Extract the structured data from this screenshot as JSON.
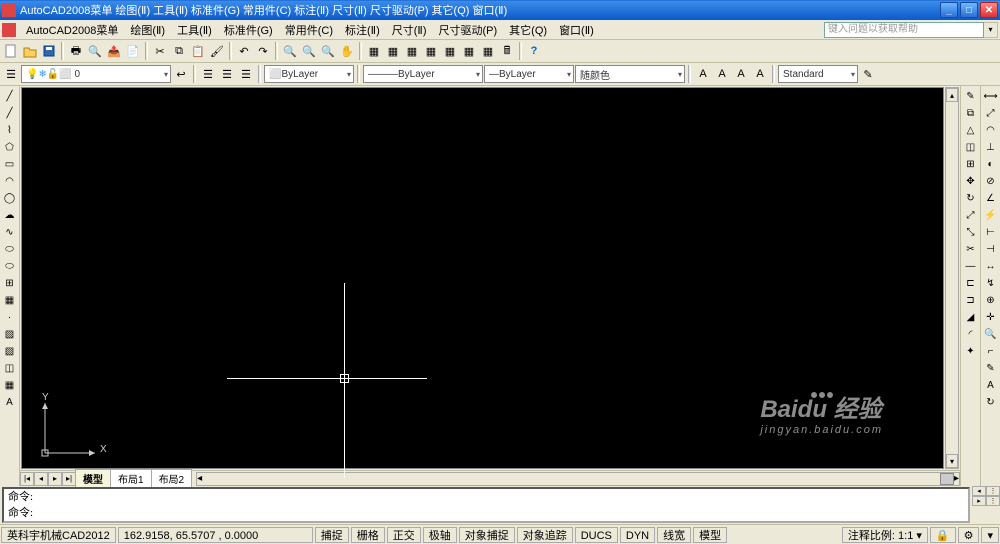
{
  "title": "AutoCAD2008菜单  绘图(Ⅱ)  工具(Ⅱ)  标准件(G)  常用件(C)  标注(Ⅱ)  尺寸(Ⅱ)  尺寸驱动(P)  其它(Q)  窗口(Ⅱ)",
  "app_title": "AutoCAD2008菜单",
  "help_placeholder": "键入问题以获取帮助",
  "menus": {
    "m0": "绘图(Ⅱ)",
    "m1": "工具(Ⅱ)",
    "m2": "标准件(G)",
    "m3": "常用件(C)",
    "m4": "标注(Ⅱ)",
    "m5": "尺寸(Ⅱ)",
    "m6": "尺寸驱动(P)",
    "m7": "其它(Q)",
    "m8": "窗口(Ⅱ)"
  },
  "layer_props": {
    "layer_current": "0",
    "bylayer": "ByLayer",
    "lt_bylayer": "ByLayer",
    "lw_bylayer": "ByLayer",
    "color_bycolor": "随颜色",
    "standard": "Standard"
  },
  "tabs": {
    "model": "模型",
    "layout1": "布局1",
    "layout2": "布局2"
  },
  "cmd": {
    "line1": "命令:",
    "line2": "命令:"
  },
  "status": {
    "app": "英科宇机械CAD2012",
    "coords": "162.9158, 65.5707 , 0.0000",
    "snap": "捕捉",
    "grid": "栅格",
    "ortho": "正交",
    "polar": "极轴",
    "osnap": "对象捕捉",
    "otrack": "对象追踪",
    "ducs": "DUCS",
    "dyn": "DYN",
    "lwt": "线宽",
    "model": "模型",
    "annoscale": "注释比例:",
    "scale": "1:1"
  },
  "axes": {
    "x": "X",
    "y": "Y"
  },
  "watermark": {
    "main": "Baidu 经验",
    "sub": "jingyan.baidu.com"
  }
}
